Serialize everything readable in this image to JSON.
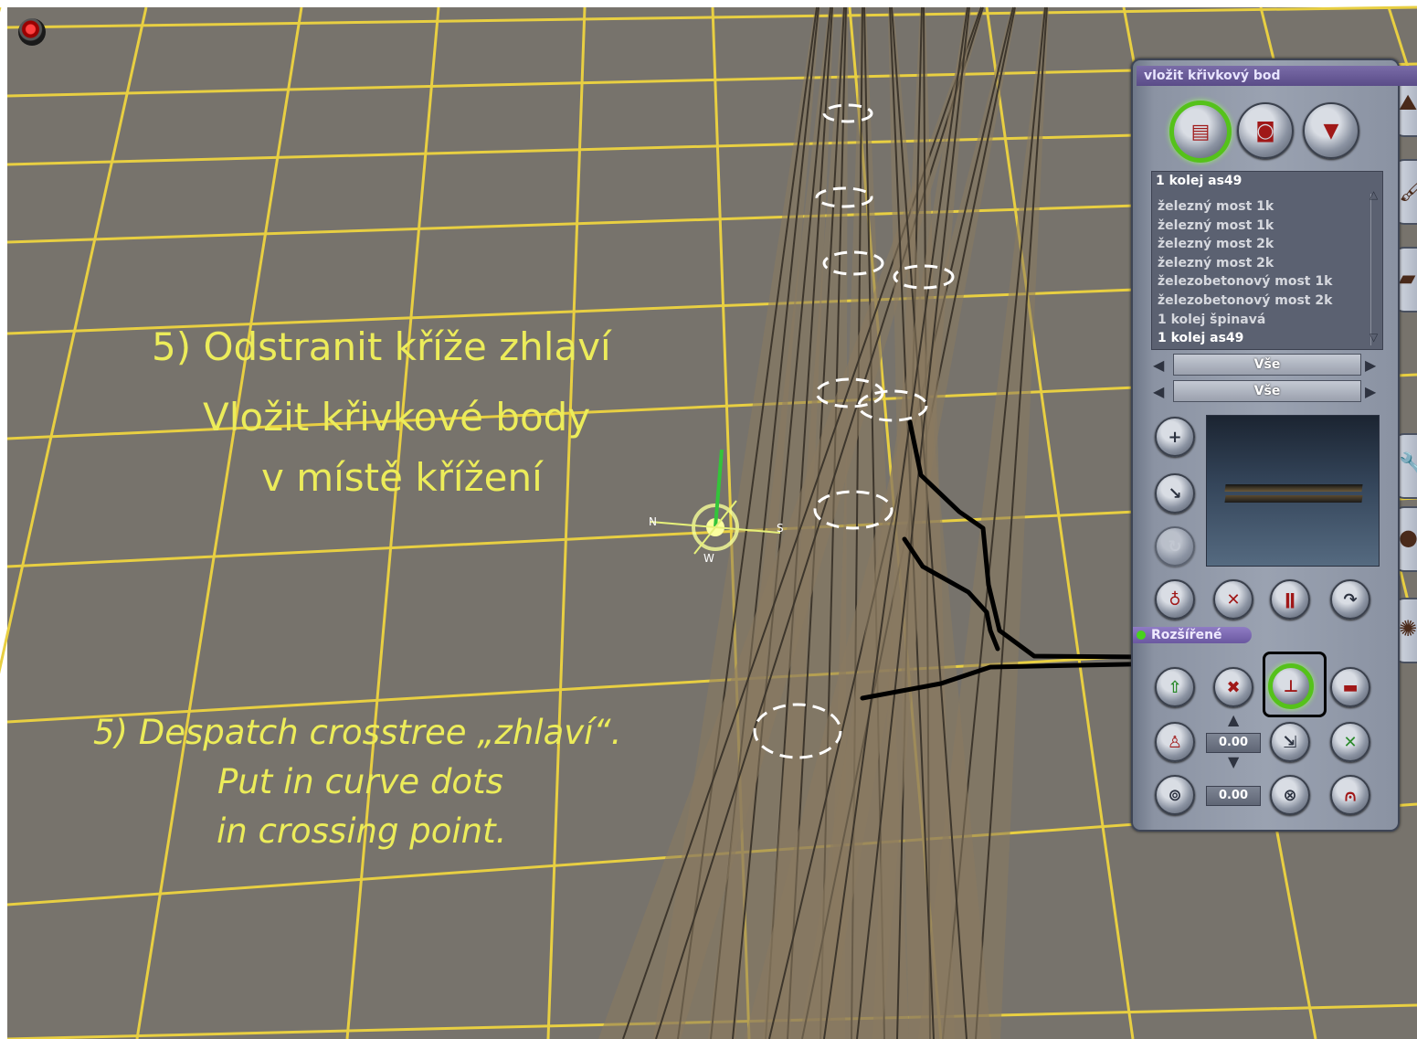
{
  "annotations": {
    "cz_step": "5) Odstranit kříže zhlaví",
    "cz_line2": "Vložit křivkové body",
    "cz_line3": "v místě křížení",
    "en_step": "5) Despatch crosstree „zhlaví“.",
    "en_line2": "Put in curve dots",
    "en_line3": "in crossing point."
  },
  "panel": {
    "title": "vložit křivkový bod",
    "top_buttons": [
      {
        "name": "track-tool-icon",
        "active": true
      },
      {
        "name": "train-tool-icon",
        "active": false
      },
      {
        "name": "marker-tool-icon",
        "active": false
      }
    ],
    "list": {
      "header": "1 kolej as49",
      "items": [
        "železný most 1k",
        "železný most 1k",
        "železný most 2k",
        "železný most 2k",
        "železobetonový most 1k",
        "železobetonový most 2k",
        "1 kolej špinavá",
        "1 kolej as49"
      ],
      "selected_index": 7
    },
    "filters": [
      "Vše",
      "Vše"
    ],
    "advanced_label": "Rozšířené",
    "value1": "0.00",
    "value2": "0.00"
  },
  "colors": {
    "ground": "#77736c",
    "grid": "#e8cf42",
    "annotation_text": "#ecec5a",
    "track_ballast": "#8b7a60",
    "panel_title": "#5a4c88",
    "active_ring": "#55c21a"
  }
}
